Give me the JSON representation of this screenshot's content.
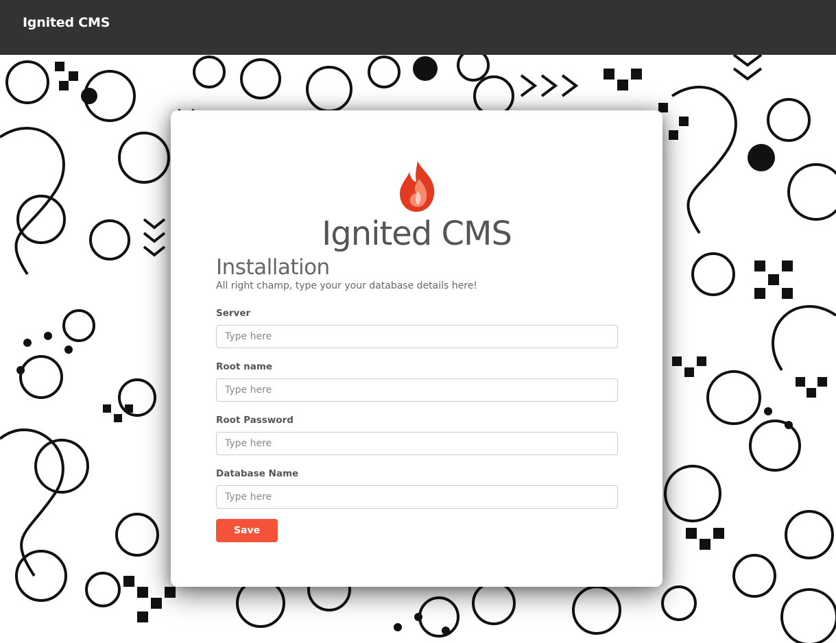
{
  "header": {
    "brand": "Ignited CMS"
  },
  "logo": {
    "icon": "flame-icon",
    "text": "Ignited CMS",
    "colors": {
      "flame_outer": "#e8402a",
      "flame_inner": "#f6735a"
    }
  },
  "install": {
    "title": "Installation",
    "subtitle": "All right champ, type your your database details here!",
    "fields": [
      {
        "label": "Server",
        "placeholder": "Type here",
        "value": ""
      },
      {
        "label": "Root name",
        "placeholder": "Type here",
        "value": ""
      },
      {
        "label": "Root Password",
        "placeholder": "Type here",
        "value": ""
      },
      {
        "label": "Database Name",
        "placeholder": "Type here",
        "value": ""
      }
    ],
    "save_label": "Save"
  },
  "colors": {
    "topbar": "#333333",
    "accent": "#f4533a"
  }
}
